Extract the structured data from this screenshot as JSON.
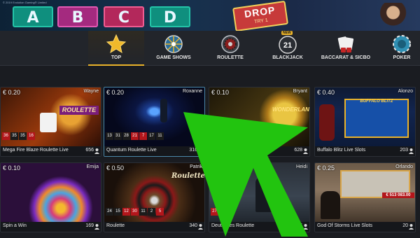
{
  "banner": {
    "legal_text": "© 2019 Evolution Gaming® Limited",
    "tiles": [
      "A",
      "B",
      "C",
      "D"
    ],
    "drop_badge_line1": "DROP",
    "drop_badge_line2": "TRY 1"
  },
  "nav": {
    "items": [
      {
        "label": "TOP",
        "icon": "star-icon",
        "active": true
      },
      {
        "label": "GAME SHOWS",
        "icon": "wheel-icon"
      },
      {
        "label": "ROULETTE",
        "icon": "roulette-icon"
      },
      {
        "label": "BLACKJACK",
        "icon": "blackjack-21-icon",
        "badge": "NEW"
      },
      {
        "label": "BACCARAT & SICBO",
        "icon": "cards-dice-icon"
      },
      {
        "label": "POKER",
        "icon": "poker-chip-icon"
      }
    ]
  },
  "cards": [
    {
      "price": "€ 0.20",
      "dealer": "Wayne",
      "title": "Mega Fire Blaze Roulette Live",
      "players": "656",
      "art_text": "ROULETTE",
      "results": [
        {
          "n": "36",
          "c": "red"
        },
        {
          "n": "35",
          "c": "black"
        },
        {
          "n": "35",
          "c": "black"
        },
        {
          "n": "16",
          "c": "red"
        }
      ]
    },
    {
      "price": "€ 0.20",
      "dealer": "Roxanne",
      "title": "Quantum Roulette Live",
      "players": "316",
      "results": [
        {
          "n": "13",
          "c": "black"
        },
        {
          "n": "31",
          "c": "black"
        },
        {
          "n": "28",
          "c": "black"
        },
        {
          "n": "21",
          "c": "red"
        },
        {
          "n": "7",
          "c": "red"
        },
        {
          "n": "17",
          "c": "black"
        },
        {
          "n": "11",
          "c": "black"
        }
      ]
    },
    {
      "price": "€ 0.10",
      "dealer": "Bryant",
      "title": "Adv…",
      "players": "628",
      "art_text": "WONDERLAND"
    },
    {
      "price": "€ 0.40",
      "dealer": "Alonzo",
      "title": "Buffalo Blitz Live Slots",
      "players": "203",
      "art_text": "BUFFALO BLITZ"
    },
    {
      "price": "€ 0.10",
      "dealer": "Emija",
      "title": "Spin a Win",
      "players": "169"
    },
    {
      "price": "€ 0.50",
      "dealer": "Patrik",
      "title": "Roulette",
      "players": "340",
      "art_text": "Roulette",
      "results": [
        {
          "n": "24",
          "c": "black"
        },
        {
          "n": "15",
          "c": "black"
        },
        {
          "n": "12",
          "c": "red"
        },
        {
          "n": "30",
          "c": "red"
        },
        {
          "n": "11",
          "c": "black"
        },
        {
          "n": "2",
          "c": "black"
        },
        {
          "n": "5",
          "c": "red"
        }
      ]
    },
    {
      "price": "€ 0.5…",
      "dealer": "Heidi",
      "title": "Deutsches Roulette",
      "players": "26",
      "flag": true,
      "results": [
        {
          "n": "27",
          "c": "red"
        }
      ]
    },
    {
      "price": "€ 0.25",
      "dealer": "Orlando",
      "title": "God Of Storms Live Slots",
      "players": "20",
      "art_text": "€ 513 083.00"
    }
  ],
  "colors": {
    "accent": "#e9b22a",
    "overlay_arrow": "#22c40f",
    "page_bg": "#1a1c21",
    "nav_bg": "#22252b"
  }
}
